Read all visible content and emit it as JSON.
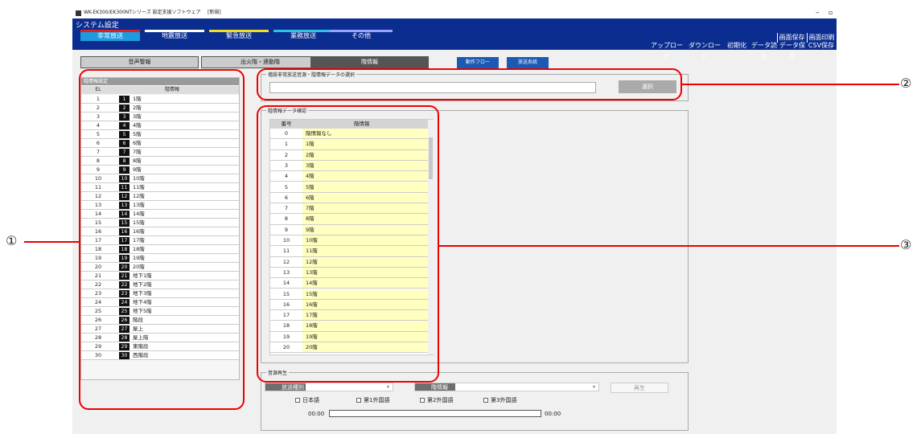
{
  "window": {
    "title": "WK-EK300/EK300NTシリーズ 設定支援ソフトウェア",
    "doc": "[新規]"
  },
  "header": {
    "system_title": "システム設定",
    "tabs": [
      {
        "label": "非常放送",
        "color": "#e02020"
      },
      {
        "label": "地震放送",
        "color": "#ffffff"
      },
      {
        "label": "緊急放送",
        "color": "#f0e020"
      },
      {
        "label": "業務放送",
        "color": "#30c0e0"
      },
      {
        "label": "その他",
        "color": "#9aa0ff"
      }
    ],
    "top_buttons": [
      "画面保存",
      "画面印刷"
    ],
    "right_buttons": [
      "アップロード",
      "ダウンロード",
      "初期化",
      "データ読込",
      "データ保存",
      "CSV保存"
    ]
  },
  "subnav": {
    "buttons": [
      "音声警報",
      "出火階・連動階",
      "階情報"
    ],
    "flow_button": "動作フロー",
    "system_button": "放送系統"
  },
  "floor_panel": {
    "title": "階情報設定",
    "col_el": "EL",
    "col_info": "階情報",
    "rows": [
      [
        "1",
        "1",
        "1階"
      ],
      [
        "2",
        "2",
        "2階"
      ],
      [
        "3",
        "3",
        "3階"
      ],
      [
        "4",
        "4",
        "4階"
      ],
      [
        "5",
        "5",
        "5階"
      ],
      [
        "6",
        "6",
        "6階"
      ],
      [
        "7",
        "7",
        "7階"
      ],
      [
        "8",
        "8",
        "8階"
      ],
      [
        "9",
        "9",
        "9階"
      ],
      [
        "10",
        "10",
        "10階"
      ],
      [
        "11",
        "11",
        "11階"
      ],
      [
        "12",
        "12",
        "12階"
      ],
      [
        "13",
        "13",
        "13階"
      ],
      [
        "14",
        "14",
        "14階"
      ],
      [
        "15",
        "15",
        "15階"
      ],
      [
        "16",
        "16",
        "16階"
      ],
      [
        "17",
        "17",
        "17階"
      ],
      [
        "18",
        "18",
        "18階"
      ],
      [
        "19",
        "19",
        "19階"
      ],
      [
        "20",
        "20",
        "20階"
      ],
      [
        "21",
        "21",
        "地下1階"
      ],
      [
        "22",
        "22",
        "地下2階"
      ],
      [
        "23",
        "23",
        "地下3階"
      ],
      [
        "24",
        "24",
        "地下4階"
      ],
      [
        "25",
        "25",
        "地下5階"
      ],
      [
        "26",
        "26",
        "階段"
      ],
      [
        "27",
        "27",
        "屋上"
      ],
      [
        "28",
        "28",
        "屋上階"
      ],
      [
        "29",
        "29",
        "東階段"
      ],
      [
        "30",
        "30",
        "西階段"
      ]
    ]
  },
  "select_group": {
    "title": "増設非常放送音源・階情報データの選択",
    "input_value": "",
    "select_button": "選択"
  },
  "data_group": {
    "title": "階情報データ確認",
    "col_num": "番号",
    "col_info": "階情報",
    "rows": [
      [
        "0",
        "階情報なし"
      ],
      [
        "1",
        "1階"
      ],
      [
        "2",
        "2階"
      ],
      [
        "3",
        "3階"
      ],
      [
        "4",
        "4階"
      ],
      [
        "5",
        "5階"
      ],
      [
        "6",
        "6階"
      ],
      [
        "7",
        "7階"
      ],
      [
        "8",
        "8階"
      ],
      [
        "9",
        "9階"
      ],
      [
        "10",
        "10階"
      ],
      [
        "11",
        "11階"
      ],
      [
        "12",
        "12階"
      ],
      [
        "13",
        "13階"
      ],
      [
        "14",
        "14階"
      ],
      [
        "15",
        "15階"
      ],
      [
        "16",
        "16階"
      ],
      [
        "17",
        "17階"
      ],
      [
        "18",
        "18階"
      ],
      [
        "19",
        "19階"
      ],
      [
        "20",
        "20階"
      ]
    ]
  },
  "playback": {
    "title": "音源再生",
    "type_label": "放送種別",
    "info_label": "階情報",
    "play_button": "再生",
    "checkboxes": [
      "日本語",
      "第1外国語",
      "第2外国語",
      "第3外国語"
    ],
    "time_start": "00:00",
    "time_end": "00:00",
    "progress": 0
  },
  "callouts": [
    "①",
    "②",
    "③"
  ],
  "annotation_color": "#e00000"
}
